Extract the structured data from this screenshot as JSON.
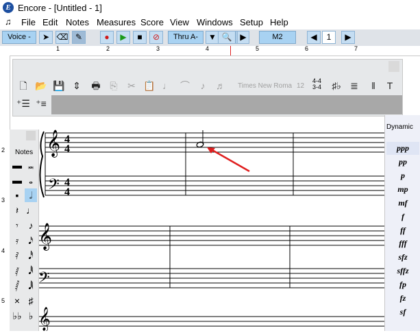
{
  "window": {
    "title": "Encore - [Untitled - 1]"
  },
  "menubar": {
    "items": [
      "File",
      "Edit",
      "Notes",
      "Measures",
      "Score",
      "View",
      "Windows",
      "Setup",
      "Help"
    ]
  },
  "toolbar": {
    "voice_label": "Voice -",
    "thru_label": "Thru A-",
    "measure_label": "M2",
    "page_number": "1"
  },
  "ruler": {
    "numbers": [
      "1",
      "2",
      "3",
      "4",
      "5",
      "6",
      "7"
    ],
    "vertical_numbers": [
      "2",
      "3",
      "4",
      "5"
    ]
  },
  "palette": {
    "font_name": "Times New Roma",
    "font_size": "12",
    "time_sig_label": "4-4",
    "time_sig_alt": "3-4"
  },
  "notes_palette": {
    "title": "Notes"
  },
  "dynamics_palette": {
    "title": "Dynamic",
    "items": [
      "ppp",
      "pp",
      "p",
      "mp",
      "mf",
      "f",
      "ff",
      "fff",
      "sfz",
      "sffz",
      "fp",
      "fz",
      "sf"
    ]
  },
  "score": {
    "time_signature": [
      "4",
      "4"
    ]
  },
  "colors": {
    "toolbar_bg": "#dfe3e8",
    "toolbar_box": "#a8d2f2",
    "record": "#d01818",
    "play": "#1a9a1a",
    "arrow": "#e02020"
  }
}
